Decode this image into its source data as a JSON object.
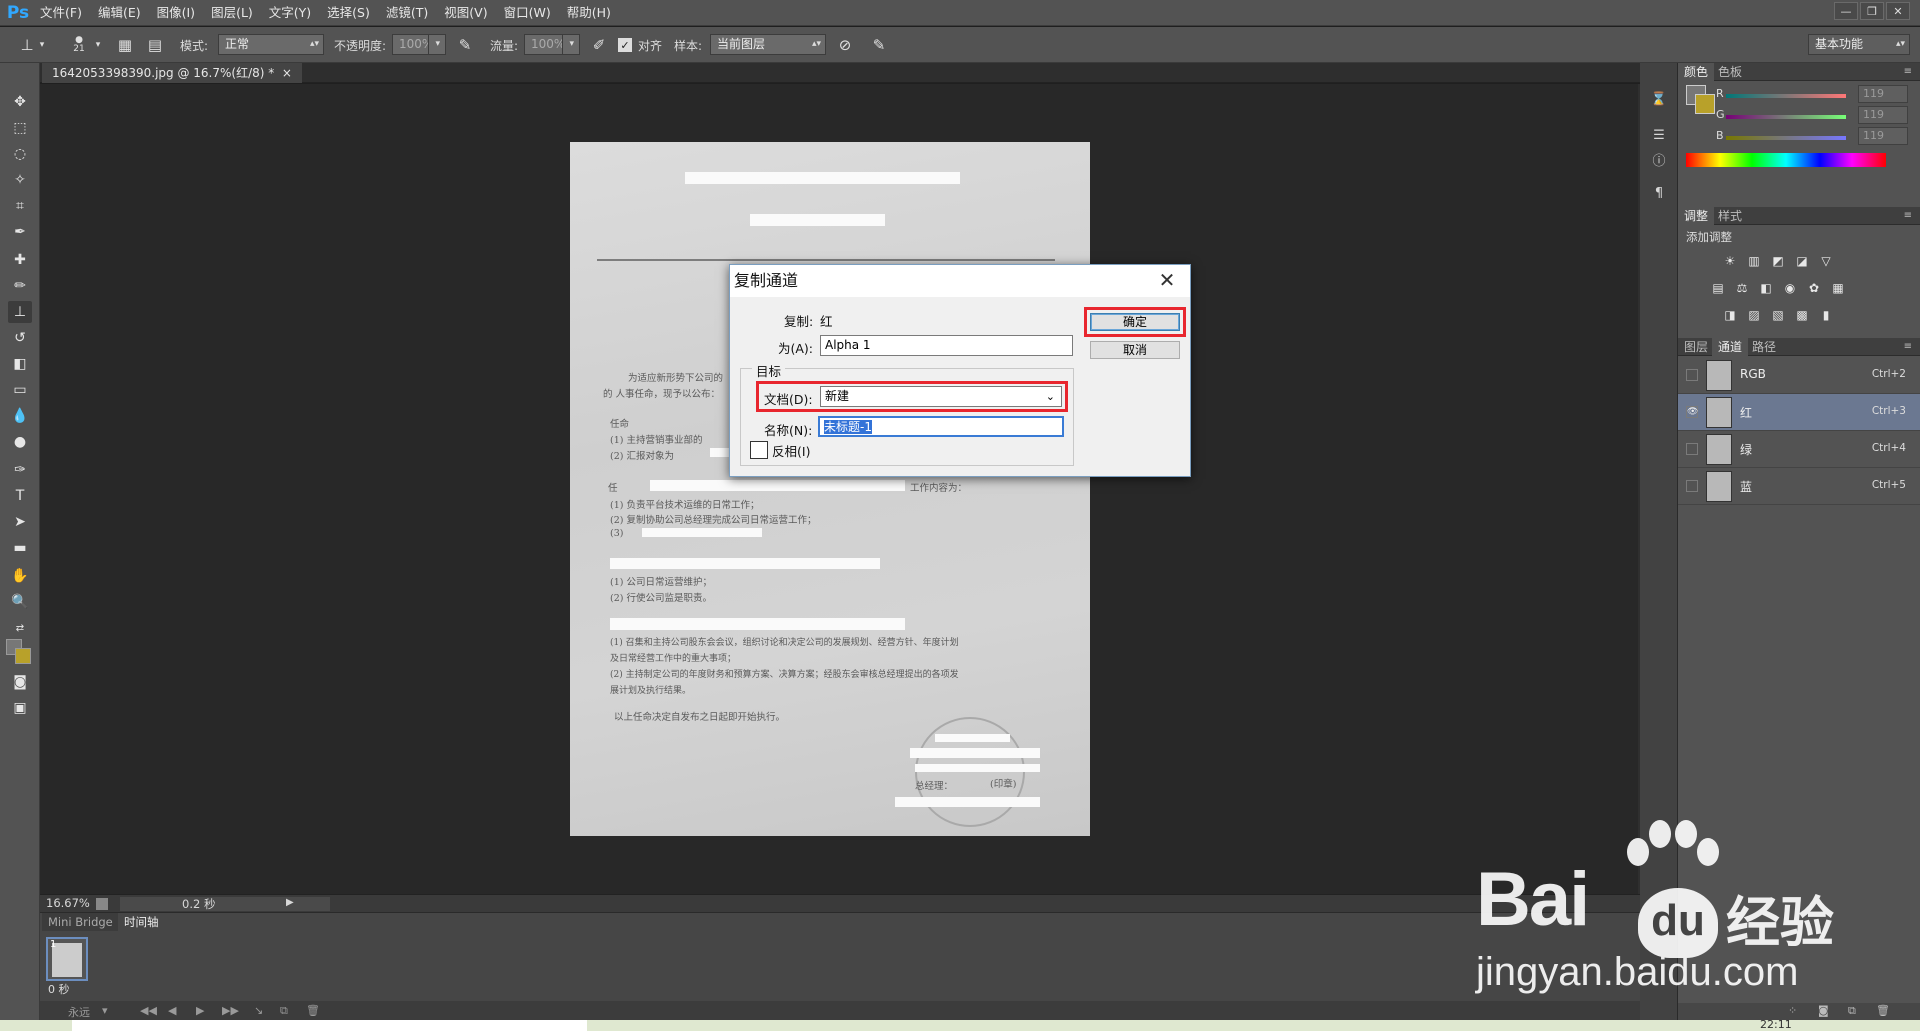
{
  "app": {
    "logo": "Ps"
  },
  "menu": [
    "文件(F)",
    "编辑(E)",
    "图像(I)",
    "图层(L)",
    "文字(Y)",
    "选择(S)",
    "滤镜(T)",
    "视图(V)",
    "窗口(W)",
    "帮助(H)"
  ],
  "window_controls": [
    "—",
    "❐",
    "✕"
  ],
  "options": {
    "brush_size": "21",
    "mode_label": "模式:",
    "mode_value": "正常",
    "opacity_label": "不透明度:",
    "opacity_value": "100%",
    "flow_label": "流量:",
    "flow_value": "100%",
    "align_label": "对齐",
    "sample_label": "样本:",
    "sample_value": "当前图层",
    "workspace": "基本功能"
  },
  "document": {
    "tab_title": "1642053398390.jpg @ 16.7%(红/8) *",
    "tab_close": "×",
    "visible_text": [
      "为适应新形势下公司的",
      "的 人事任命，现予以公布：",
      "任命",
      "(1)   主持营销事业部的",
      "(2)   汇报对象为",
      "任",
      "工作内容为：",
      "(1)   负责平台技术运维的日常工作；",
      "(2)   复制协助公司总经理完成公司日常运营工作；",
      "(3)",
      "(1)   公司日常运营维护；",
      "(2)   行使公司监是职责。",
      "(1) 召集和主持公司股东会会议，组织讨论和决定公司的发展规划、经营方针、年度计划",
      "及日常经营工作中的重大事项；",
      "(2) 主持制定公司的年度财务和预算方案、决算方案；经股东会审核总经理提出的各项发",
      "展计划及执行结果。",
      "以上任命决定自发布之日起即开始执行。",
      "总经理：",
      "(印章)"
    ]
  },
  "status": {
    "zoom": "16.67%",
    "time": "0.2 秒"
  },
  "bottom_panel": {
    "tabs": [
      "Mini Bridge",
      "时间轴"
    ],
    "frame_number": "1",
    "frame_delay": "0 秒",
    "loop": "永远"
  },
  "color_panel": {
    "tabs": [
      "颜色",
      "色板"
    ],
    "r_label": "R",
    "r_value": "119",
    "g_label": "G",
    "g_value": "119",
    "b_label": "B",
    "b_value": "119",
    "foreground": "#777777",
    "background": "#b8a12a"
  },
  "adjust_panel": {
    "tabs": [
      "调整",
      "样式"
    ],
    "add_label": "添加调整"
  },
  "channels_panel": {
    "tabs": [
      "图层",
      "通道",
      "路径"
    ],
    "channels": [
      {
        "name": "RGB",
        "key": "Ctrl+2",
        "visible": false
      },
      {
        "name": "红",
        "key": "Ctrl+3",
        "visible": true
      },
      {
        "name": "绿",
        "key": "Ctrl+4",
        "visible": false
      },
      {
        "name": "蓝",
        "key": "Ctrl+5",
        "visible": false
      }
    ]
  },
  "dialog": {
    "title": "复制通道",
    "close": "✕",
    "source_label": "复制:",
    "source_value": "红",
    "as_label": "为(A):",
    "as_value": "Alpha 1",
    "group_label": "目标",
    "doc_label": "文档(D):",
    "doc_value": "新建",
    "name_label": "名称(N):",
    "name_value": "未标题-1",
    "invert_label": "反相(I)",
    "invert_checked": false,
    "ok_label": "确定",
    "cancel_label": "取消"
  },
  "watermark": {
    "brand_text": "Bai",
    "brand_suffix": "经验",
    "domain": "jingyan.baidu.com"
  },
  "taskbar": {
    "clock": "22:11"
  }
}
